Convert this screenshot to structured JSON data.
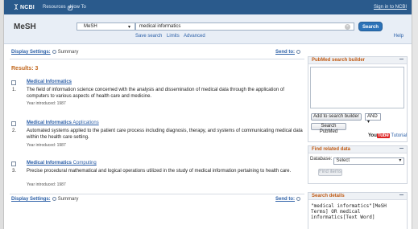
{
  "top_bar": {
    "logo": "NCBI",
    "resources": "Resources",
    "how_to": "How To",
    "sign_in": "Sign in to NCBI"
  },
  "search": {
    "title": "MeSH",
    "database": "MeSH",
    "query": "medical informatics",
    "search_button": "Search",
    "links": [
      "Save search",
      "Limits",
      "Advanced"
    ],
    "help": "Help"
  },
  "results": {
    "display_settings_label": "Display Settings:",
    "display_settings_value": "Summary",
    "send_to": "Send to:",
    "count_label": "Results: 3",
    "items": [
      {
        "number": "1.",
        "title": "Medical Informatics",
        "title_suffix": "",
        "description": "The field of information science concerned with the analysis and dissemination of medical data through the application of computers to various aspects of health care and medicine.",
        "year": "Year introduced: 1987"
      },
      {
        "number": "2.",
        "title": "Medical Informatics",
        "title_suffix": " Applications",
        "description": "Automated systems applied to the patient care process including diagnosis, therapy, and systems of communicating medical data within the health care setting.",
        "year": "Year introduced: 1987"
      },
      {
        "number": "3.",
        "title": "Medical Informatics",
        "title_suffix": " Computing",
        "description": "Precise procedural mathematical and logical operations utilized in the study of medical information pertaining to health care.",
        "year": "Year introduced: 1987"
      }
    ]
  },
  "sidebar": {
    "builder": {
      "header": "PubMed search builder",
      "add_button": "Add to search builder",
      "operator": "AND",
      "search_pubmed": "Search PubMed",
      "youtube_you": "You",
      "youtube_tube": "Tube",
      "tutorial": "Tutorial"
    },
    "related": {
      "header": "Find related data",
      "database_label": "Database:",
      "database_value": "Select",
      "find_items": "Find items"
    },
    "details": {
      "header": "Search details",
      "query_text": "\"medical informatics\"[MeSH\nTerms] OR medical\ninformatics[Text Word]"
    }
  }
}
